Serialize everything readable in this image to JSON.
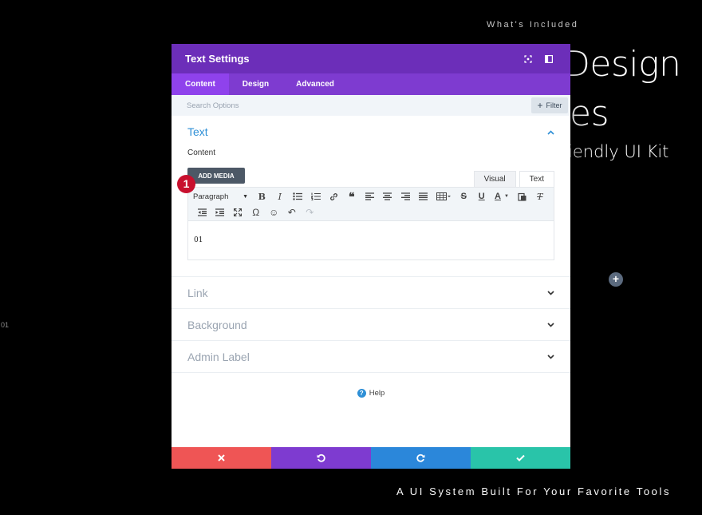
{
  "background": {
    "eyebrow": "What's Included",
    "headline_line1": "Design",
    "headline_line2": "es",
    "subheadline": "iendly UI Kit",
    "left_number": "01",
    "footer_tagline": "A UI System Built For Your Favorite Tools"
  },
  "modal": {
    "title": "Text Settings",
    "tabs": [
      {
        "label": "Content",
        "active": true
      },
      {
        "label": "Design",
        "active": false
      },
      {
        "label": "Advanced",
        "active": false
      }
    ],
    "search": {
      "placeholder": "Search Options",
      "filter_label": "Filter"
    },
    "text_section": {
      "title": "Text",
      "content_label": "Content",
      "add_media_label": "ADD MEDIA",
      "editor_tabs": [
        "Visual",
        "Text"
      ],
      "format_select": "Paragraph",
      "editor_content": "01"
    },
    "collapsed_sections": [
      "Link",
      "Background",
      "Admin Label"
    ],
    "help_label": "Help"
  },
  "badge_number": "1",
  "colors": {
    "header": "#6c2eb9",
    "tabs": "#7e3bd0",
    "active_tab": "#8f42ec",
    "cancel": "#ef5555",
    "undo": "#7e3bd0",
    "redo": "#2b87da",
    "save": "#29c4a9",
    "section_active": "#2e8fd6",
    "badge": "#c8102e"
  }
}
